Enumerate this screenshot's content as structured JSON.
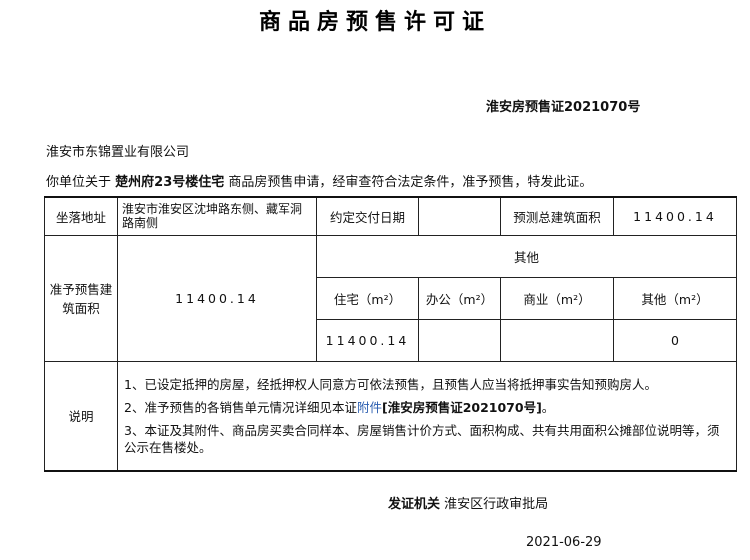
{
  "title": "商品房预售许可证",
  "cert_number": "淮安房预售证2021070号",
  "company": "淮安市东锦置业有限公司",
  "grant": {
    "prefix": "你单位关于",
    "project": "楚州府23号楼住宅",
    "suffix": "商品房预售申请，经审查符合法定条件，准予预售，特发此证。"
  },
  "table": {
    "location_label": "坐落地址",
    "location_value": "淮安市淮安区沈坤路东侧、藏军洞路南侧",
    "delivery_label": "约定交付日期",
    "delivery_value": "",
    "est_area_label": "预测总建筑面积",
    "est_area_value": "11400.14",
    "presale_area_label": "准予预售建筑面积",
    "presale_area_value": "11400.14",
    "other_header": "其他",
    "col_residential": "住宅（m²）",
    "col_office": "办公（m²）",
    "col_commercial": "商业（m²）",
    "col_other": "其他（m²）",
    "val_residential": "11400.14",
    "val_office": "",
    "val_commercial": "",
    "val_other": "0",
    "notes_label": "说明",
    "note1": "1、已设定抵押的房屋，经抵押权人同意方可依法预售，且预售人应当将抵押事实告知预购房人。",
    "note2_prefix": "2、准予预售的各销售单元情况详细见本证",
    "note2_link": "附件",
    "note2_cert": "[淮安房预售证2021070号]",
    "note2_suffix": "。",
    "note3": "3、本证及其附件、商品房买卖合同样本、房屋销售计价方式、面积构成、共有共用面积公摊部位说明等，须公示在售楼处。"
  },
  "issuer_label": "发证机关",
  "issuer_value": "淮安区行政审批局",
  "date": "2021-06-29"
}
